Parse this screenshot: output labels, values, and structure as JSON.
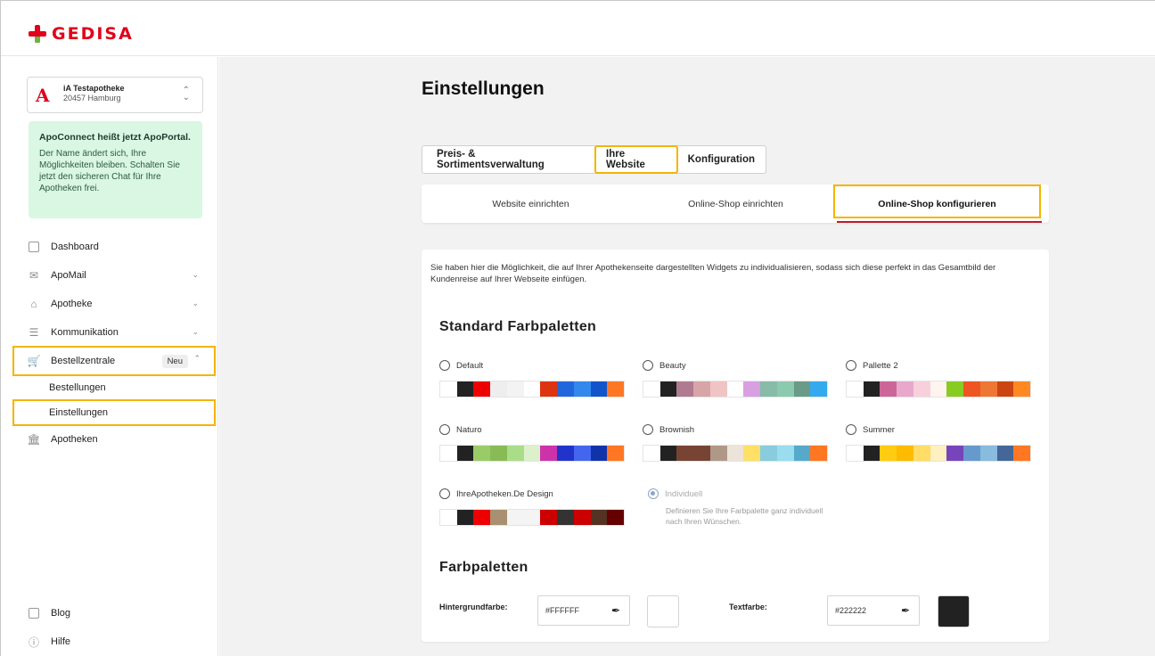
{
  "brand": {
    "logo_text": "GEDISA",
    "logo_color": "#e2001a"
  },
  "pharmacy": {
    "name": "iA Testapotheke",
    "city": "20457 Hamburg"
  },
  "notice": {
    "title": "ApoConnect heißt jetzt ApoPortal.",
    "body": "Der Name ändert sich, Ihre Möglichkeiten bleiben. Schalten Sie jetzt den sicheren Chat für Ihre Apotheken frei."
  },
  "nav": {
    "dashboard": "Dashboard",
    "apomail": "ApoMail",
    "apotheke": "Apotheke",
    "kommunikation": "Kommunikation",
    "bestellzentrale": "Bestellzentrale",
    "bestellzentrale_badge": "Neu",
    "bestellungen": "Bestellungen",
    "einstellungen": "Einstellungen",
    "apotheken": "Apotheken",
    "blog": "Blog",
    "hilfe": "Hilfe"
  },
  "page": {
    "title": "Einstellungen"
  },
  "tabs_primary": [
    "Preis- & Sortimentsverwaltung",
    "Ihre Website",
    "Konfiguration"
  ],
  "tabs_secondary": [
    "Website einrichten",
    "Online-Shop einrichten",
    "Online-Shop konfigurieren"
  ],
  "intro": "Sie haben hier die Möglichkeit, die auf Ihrer Apothekenseite dargestellten Widgets zu individualisieren, sodass sich diese perfekt in das Gesamtbild der Kundenreise auf Ihrer Webseite einfügen.",
  "section_standard": "Standard Farbpaletten",
  "section_palettes": "Farbpaletten",
  "palettes": [
    {
      "name": "Default",
      "colors": [
        "#ffffff",
        "#222222",
        "#ee0000",
        "#eeeeee",
        "#f3f3f3",
        "#ffffff",
        "#dd3311",
        "#2266dd",
        "#3388ee",
        "#1155cc",
        "#ff7722"
      ]
    },
    {
      "name": "Beauty",
      "colors": [
        "#ffffff",
        "#222222",
        "#b07a90",
        "#d8a4a8",
        "#f0c4c4",
        "#ffffff",
        "#d8a0e0",
        "#88bba8",
        "#8ccab0",
        "#6a9a88",
        "#33aaee"
      ]
    },
    {
      "name": "Pallette 2",
      "colors": [
        "#ffffff",
        "#222222",
        "#cc6699",
        "#e8a8cc",
        "#f8d0dc",
        "#fff4f0",
        "#88cc22",
        "#ee5522",
        "#ee7733",
        "#cc4411",
        "#ff8822"
      ]
    },
    {
      "name": "Naturo",
      "colors": [
        "#ffffff",
        "#222222",
        "#99cc66",
        "#88bb55",
        "#aadd88",
        "#ddf0cc",
        "#cc33aa",
        "#2233cc",
        "#4466ee",
        "#1133aa",
        "#ff7722"
      ]
    },
    {
      "name": "Brownish",
      "colors": [
        "#ffffff",
        "#222222",
        "#774433",
        "#774433",
        "#b09888",
        "#ece4d8",
        "#ffe066",
        "#88ccdd",
        "#99ddee",
        "#55aacc",
        "#ff7722"
      ]
    },
    {
      "name": "Summer",
      "colors": [
        "#ffffff",
        "#222222",
        "#ffcc11",
        "#ffbb00",
        "#ffdd66",
        "#fff0c0",
        "#7744bb",
        "#6699cc",
        "#88bbdd",
        "#446699",
        "#ff7722"
      ]
    },
    {
      "name": "IhreApotheken.De Design",
      "colors": [
        "#ffffff",
        "#222222",
        "#ee0000",
        "#a89070",
        "#f4f4f4",
        "#f4f4f4",
        "#cc0000",
        "#333333",
        "#cc0000",
        "#553322",
        "#660000"
      ]
    }
  ],
  "individuell": {
    "name": "Individuell",
    "description": "Definieren Sie Ihre Farbpalette ganz individuell nach Ihren Wünschen."
  },
  "colors_form": {
    "background_label": "Hintergrundfarbe:",
    "background_value": "#FFFFFF",
    "text_label": "Textfarbe:",
    "text_value": "#222222"
  }
}
